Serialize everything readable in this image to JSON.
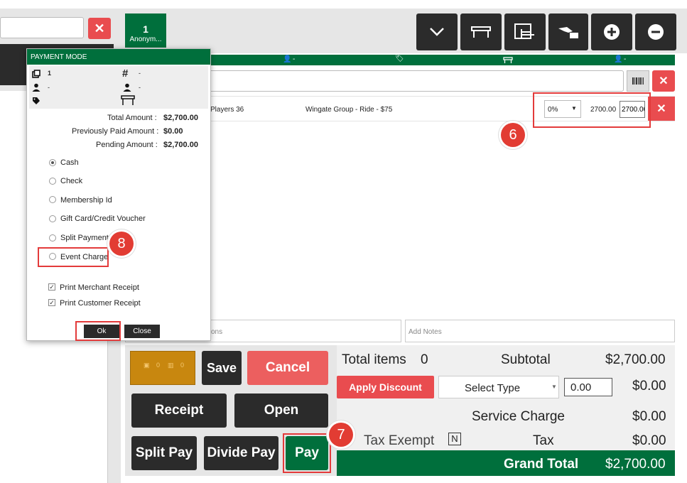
{
  "ticket": {
    "number": "1",
    "name": "Anonym..."
  },
  "header_bar": {
    "guest_count": "-",
    "seat_label": "-"
  },
  "line_item": {
    "description": "Players 36",
    "package": "Wingate Group - Ride - $75",
    "discount_select": "0%",
    "price": "2700.00",
    "total": "2700.00"
  },
  "notes": {
    "placeholder_left": "ons",
    "placeholder_right": "Add Notes"
  },
  "dialog": {
    "title": "PAYMENT MODE",
    "info": {
      "copies": "1",
      "hash": "-",
      "person1": "-",
      "person2": "-"
    },
    "amounts": {
      "total_label": "Total Amount :",
      "total_value": "$2,700.00",
      "paid_label": "Previously Paid Amount :",
      "paid_value": "$0.00",
      "pending_label": "Pending Amount :",
      "pending_value": "$2,700.00"
    },
    "options": [
      "Cash",
      "Check",
      "Membership Id",
      "Gift Card/Credit Voucher",
      "Split Payment",
      "Event Charge"
    ],
    "selected_option": "Cash",
    "print_merchant": "Print Merchant Receipt",
    "print_customer": "Print Customer Receipt",
    "ok": "Ok",
    "close": "Close"
  },
  "buttons": {
    "save": "Save",
    "cancel": "Cancel",
    "receipt": "Receipt",
    "open": "Open",
    "split_pay": "Split Pay",
    "divide_pay": "Divide Pay",
    "pay": "Pay",
    "apply_discount": "Apply Discount"
  },
  "gold_tile": {
    "a": "0",
    "b": "0"
  },
  "summary": {
    "total_items_label": "Total items",
    "total_items_value": "0",
    "subtotal_label": "Subtotal",
    "subtotal_value": "$2,700.00",
    "select_type": "Select Type",
    "discount_input": "0.00",
    "discount_value": "$0.00",
    "service_charge_label": "Service Charge",
    "service_charge_value": "$0.00",
    "tax_exempt_label": "Tax Exempt",
    "tax_exempt_flag": "N",
    "tax_label": "Tax",
    "tax_value": "$0.00",
    "grand_total_label": "Grand Total",
    "grand_total_value": "$2,700.00"
  },
  "callouts": {
    "six": "6",
    "seven": "7",
    "eight": "8"
  },
  "colors": {
    "green": "#006f3c",
    "red": "#e94c4f",
    "dark": "#2b2b2b",
    "gold": "#c8870f"
  }
}
